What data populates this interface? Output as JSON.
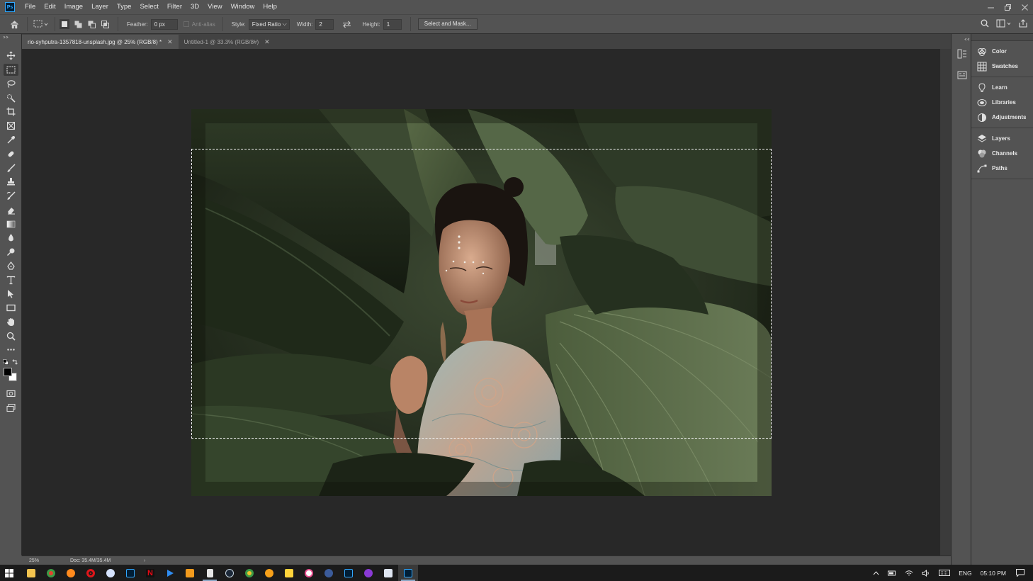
{
  "app": {
    "logo_text": "Ps",
    "menu": [
      "File",
      "Edit",
      "Image",
      "Layer",
      "Type",
      "Select",
      "Filter",
      "3D",
      "View",
      "Window",
      "Help"
    ]
  },
  "options": {
    "feather_label": "Feather:",
    "feather_value": "0 px",
    "antialias_label": "Anti-alias",
    "style_label": "Style:",
    "style_value": "Fixed Ratio",
    "width_label": "Width:",
    "width_value": "2",
    "height_label": "Height:",
    "height_value": "1",
    "select_mask_label": "Select and Mask..."
  },
  "tabs": [
    {
      "label": "rio-syhputra-1357818-unsplash.jpg @ 25% (RGB/8) *",
      "active": true
    },
    {
      "label": "Untitled-1 @ 33.3% (RGB/8#)",
      "active": false
    }
  ],
  "tools": [
    "move-tool",
    "rectangular-marquee-tool",
    "lasso-tool",
    "quick-selection-tool",
    "crop-tool",
    "frame-tool",
    "eyedropper-tool",
    "spot-healing-brush-tool",
    "brush-tool",
    "clone-stamp-tool",
    "history-brush-tool",
    "eraser-tool",
    "gradient-tool",
    "blur-tool",
    "dodge-tool",
    "pen-tool",
    "type-tool",
    "path-selection-tool",
    "rectangle-tool",
    "hand-tool",
    "zoom-tool",
    "edit-toolbar"
  ],
  "status": {
    "zoom": "25%",
    "doc_size": "Doc: 35.4M/35.4M",
    "arrow": "›"
  },
  "panels": {
    "group1": [
      "Color",
      "Swatches"
    ],
    "group2": [
      "Learn",
      "Libraries",
      "Adjustments"
    ],
    "group3": [
      "Layers",
      "Channels",
      "Paths"
    ]
  },
  "taskbar": {
    "language": "ENG",
    "time": "05:10 PM"
  },
  "colors": {
    "foreground": "#000000",
    "background": "#ffffff"
  }
}
